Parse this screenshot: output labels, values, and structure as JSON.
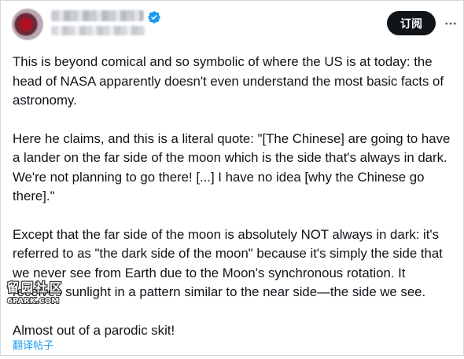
{
  "post": {
    "subscribe_label": "订阅",
    "paragraphs": [
      "This is beyond comical and so symbolic of where the US is at today: the head of NASA apparently doesn't even understand the most basic facts of astronomy.",
      "Here he claims, and this is a literal quote: \"[The Chinese] are going to have a lander on the far side of the moon which is the side that's always in dark. We're not planning to go there! [...] I have no idea [why the Chinese go there].\"",
      "Except that the far side of the moon is absolutely NOT always in dark: it's referred to as \"the dark side of the moon\" because it's simply the side that we never see from Earth due to the Moon's synchronous rotation. It receives sunlight in a pattern similar to the near side—the side we see.",
      "Almost out of a parodic skit!"
    ],
    "translate_label": "翻译帖子"
  },
  "watermark": {
    "line1": "留园社区",
    "line2": "6PARK.COM"
  },
  "colors": {
    "accent": "#1d9bf0",
    "button_bg": "#0f1419",
    "text": "#0f1419",
    "border": "#cfd9de"
  },
  "icons": {
    "verified": "verified-badge-icon",
    "more": "more-options-icon"
  }
}
